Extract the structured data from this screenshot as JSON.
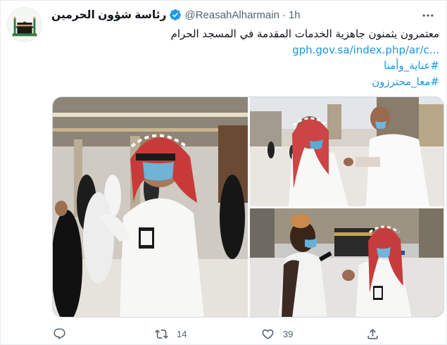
{
  "tweet": {
    "display_name": "رئاسة شؤون الحرمين",
    "handle": "@ReasahAlharmain",
    "separator": "·",
    "time": "1h",
    "body": "معتمرون يثمنون جاهزية الخدمات المقدمة في المسجد الحرام",
    "link": "gph.gov.sa/index.php/ar/c...",
    "hashtags": [
      "#عناية_وأمنا",
      "#معا_محترزون"
    ]
  },
  "actions": {
    "reply_count": "",
    "retweet_count": "14",
    "like_count": "39"
  },
  "icons": {
    "verified": "verified-badge-icon",
    "more": "more-options-icon",
    "reply": "reply-icon",
    "retweet": "retweet-icon",
    "like": "heart-icon",
    "share": "share-icon"
  },
  "colors": {
    "link": "#1b95e0",
    "verified": "#1d9bf0",
    "muted": "#536471"
  }
}
